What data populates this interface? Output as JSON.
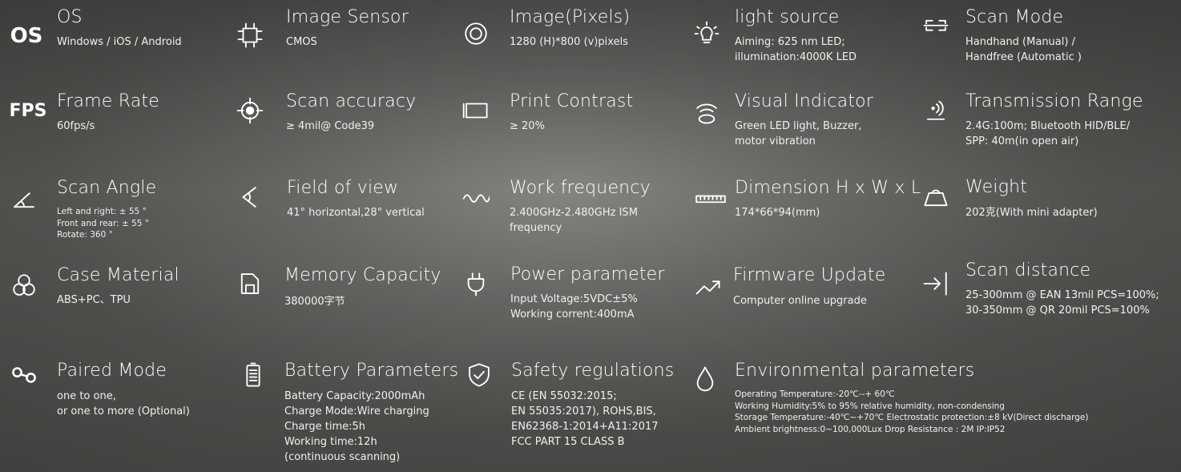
{
  "specs": {
    "os": {
      "title": "OS",
      "icon_text": "OS",
      "lines": [
        "Windows / iOS / Android"
      ]
    },
    "image_sensor": {
      "title": "Image Sensor",
      "icon": "chip-icon",
      "lines": [
        "CMOS"
      ]
    },
    "image_pixels": {
      "title": "Image(Pixels)",
      "icon": "target-circle-icon",
      "lines": [
        "1280 (H)*800 (v)pixels"
      ]
    },
    "light_source": {
      "title": "light source",
      "icon": "bulb-icon",
      "lines": [
        "Aiming: 625 nm LED;",
        "illumination:4000K LED"
      ]
    },
    "scan_mode": {
      "title": "Scan Mode",
      "icon": "scan-frame-icon",
      "lines": [
        "Handhand (Manual) /",
        "Handfree (Automatic )"
      ]
    },
    "frame_rate": {
      "title": "Frame Rate",
      "icon_text": "FPS",
      "lines": [
        "60fps/s"
      ]
    },
    "scan_accuracy": {
      "title": "Scan accuracy",
      "icon": "crosshair-icon",
      "lines": [
        "≥ 4mil@ Code39"
      ]
    },
    "print_contrast": {
      "title": "Print Contrast",
      "icon": "rectangle-icon",
      "lines": [
        "≥ 20%"
      ]
    },
    "visual_indicator": {
      "title": "Visual Indicator",
      "icon": "signal-icon",
      "lines": [
        "Green LED light, Buzzer,",
        "motor vibration"
      ]
    },
    "transmission_range": {
      "title": "Transmission Range",
      "icon": "wireless-icon",
      "lines": [
        "2.4G:100m; Bluetooth HID/BLE/",
        "SPP: 40m(in open air)"
      ]
    },
    "scan_angle": {
      "title": "Scan Angle",
      "icon": "angle-icon",
      "lines": [
        "Left and right:  ± 55 °",
        "Front and rear:  ± 55 °",
        "Rotate:  360 °"
      ]
    },
    "field_of_view": {
      "title": "Field of view",
      "icon": "view-angle-icon",
      "lines": [
        "41° horizontal,28° vertical"
      ]
    },
    "work_frequency": {
      "title": "Work frequency",
      "icon": "wave-icon",
      "lines": [
        "2.400GHz-2.480GHz ISM",
        "frequency"
      ]
    },
    "dimension": {
      "title": "Dimension H x W x L",
      "icon": "ruler-icon",
      "lines": [
        "174*66*94(mm)"
      ]
    },
    "weight": {
      "title": "Weight",
      "icon": "weight-icon",
      "lines": [
        "202克(With mini adapter)"
      ]
    },
    "case_material": {
      "title": "Case Material",
      "icon": "circles-icon",
      "lines": [
        "ABS+PC、TPU"
      ]
    },
    "memory_capacity": {
      "title": "Memory Capacity",
      "icon": "memory-icon",
      "lines": [
        "380000字节"
      ]
    },
    "power_parameter": {
      "title": "Power parameter",
      "icon": "plug-icon",
      "lines": [
        "Input Voltage:5VDC±5%",
        "Working corrent:400mA"
      ]
    },
    "firmware_update": {
      "title": "Firmware Update",
      "icon": "trend-icon",
      "lines": [
        "Computer online upgrade"
      ]
    },
    "scan_distance": {
      "title": "Scan distance",
      "icon": "arrow-bar-icon",
      "lines": [
        "25-300mm @ EAN 13mil PCS=100%;",
        "30-350mm @ QR 20mil PCS=100%"
      ]
    },
    "paired_mode": {
      "title": "Paired Mode",
      "icon": "link-icon",
      "lines": [
        "one to one,",
        "or one to more (Optional)"
      ]
    },
    "battery": {
      "title": "Battery Parameters",
      "icon": "battery-icon",
      "lines": [
        "Battery Capacity:2000mAh",
        "Charge Mode:Wire charging",
        "Charge time:5h",
        "Working time:12h",
        "(continuous scanning)"
      ]
    },
    "safety": {
      "title": "Safety regulations",
      "icon": "shield-check-icon",
      "lines": [
        "CE (EN 55032:2015;",
        "EN 55035:2017), ROHS,BIS,",
        "EN62368-1:2014+A11:2017",
        "FCC PART 15 CLASS B"
      ]
    },
    "environmental": {
      "title": "Environmental parameters",
      "icon": "drop-icon",
      "lines": [
        "Operating Temperature:-20℃--+ 60℃",
        "Working Humidity:5% to 95% relative humidity, non-condensing",
        "Storage Temperature:-40℃~+70℃   Electrostatic protection:±8 kV(Direct discharge)",
        "Ambient brightness:0~100,000Lux      Drop Resistance : 2M             IP:IP52"
      ]
    }
  }
}
